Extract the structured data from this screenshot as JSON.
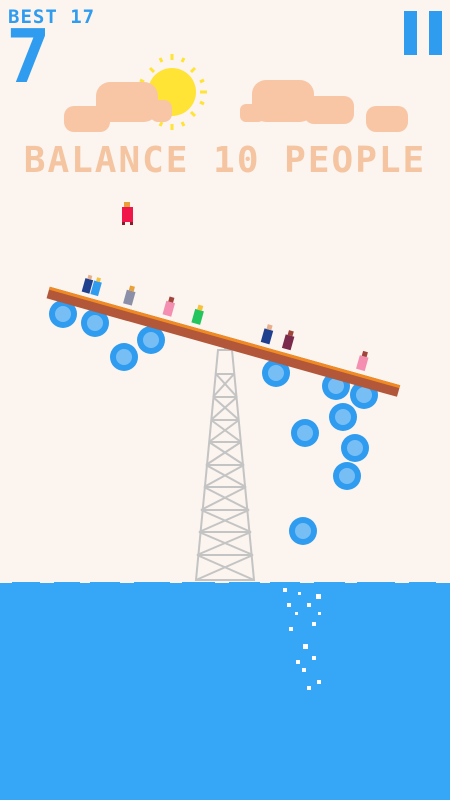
{
  "hud": {
    "best_label": "BEST 17",
    "score": "7"
  },
  "goal_text": "BALANCE 10 PEOPLE",
  "icons": {
    "pause": "pause-icon",
    "sun": "sun-icon",
    "cloud": "cloud-icon",
    "balloon": "balloon-icon",
    "tower": "tower-icon"
  },
  "colors": {
    "accent_blue": "#2f9cf0",
    "water": "#36a7f7",
    "sky": "#fbf4ef",
    "cloud": "#f8c6a4",
    "sun": "#ffe335",
    "plank_top": "#f08a22",
    "plank_body": "#b2573a",
    "goal_text": "#f4c5a0"
  },
  "game": {
    "people_goal": 10,
    "people_on_plank": 8,
    "falling_people": 1
  }
}
